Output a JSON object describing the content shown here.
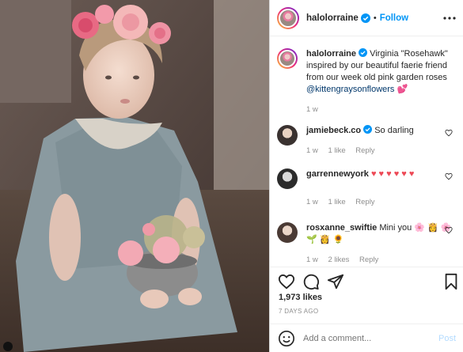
{
  "post": {
    "username": "halolorraine",
    "follow_label": "Follow",
    "caption_user": "halolorraine",
    "caption_text": "Virginia \"Rosehawk\" inspired by our beautiful faerie friend from our week old pink garden roses",
    "caption_mention": "@kittengraysonflowers",
    "caption_emoji": "💕",
    "caption_time": "1 w",
    "photo_alt": "child with pink roses in hair holding a bowl of flowers"
  },
  "comments": [
    {
      "user": "jamiebeck.co",
      "text": "So darling",
      "time": "1 w",
      "likes": "1 like",
      "reply": "Reply"
    },
    {
      "user": "garrennewyork",
      "text": "♥ ♥ ♥ ♥ ♥ ♥",
      "time": "1 w",
      "likes": "1 like",
      "reply": "Reply"
    },
    {
      "user": "rosxanne_swiftie",
      "text": "Mini you",
      "emojis": "🌸 👸 🌸",
      "emojis2": "🌱 👸 🌻",
      "time": "1 w",
      "likes": "2 likes",
      "reply": "Reply"
    }
  ],
  "actions": {
    "likes_count": "1,973 likes",
    "time_ago": "7 DAYS AGO"
  },
  "add_comment": {
    "placeholder": "Add a comment...",
    "post_label": "Post"
  },
  "colors": {
    "link_blue": "#0095f6",
    "heart_red": "#ed4956",
    "meta_gray": "#8e8e8e"
  }
}
